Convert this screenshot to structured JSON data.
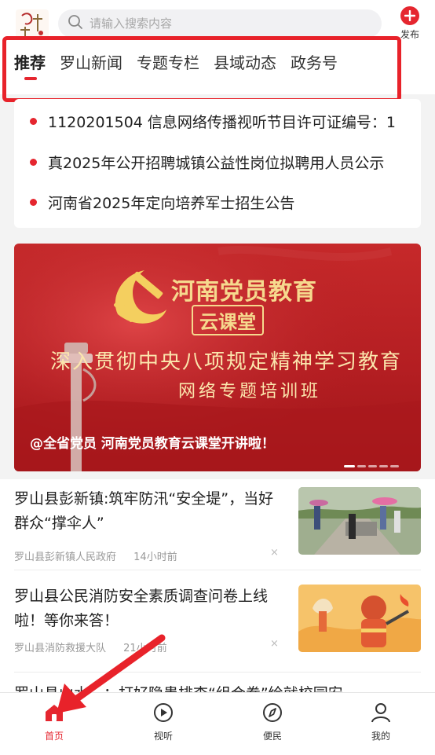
{
  "header": {
    "search_placeholder": "请输入搜索内容",
    "publish_label": "发布"
  },
  "tabs": [
    {
      "label": "推荐",
      "active": true
    },
    {
      "label": "罗山新闻",
      "active": false
    },
    {
      "label": "专题专栏",
      "active": false
    },
    {
      "label": "县域动态",
      "active": false
    },
    {
      "label": "政务号",
      "active": false
    }
  ],
  "notices": [
    "1120201504  信息网络传播视听节目许可证编号：1",
    "真2025年公开招聘城镇公益性岗位拟聘用人员公示",
    "河南省2025年定向培养军士招生公告"
  ],
  "banner": {
    "title": "河南党员教育",
    "subtitle": "云课堂",
    "line1": "深入贯彻中央八项规定精神学习教育",
    "line2": "网络专题培训班",
    "caption": "@全省党员 河南党员教育云课堂开讲啦！",
    "slide_count": 5,
    "active_slide": 1
  },
  "articles": [
    {
      "title": "罗山县彭新镇:筑牢防汛“安全堤”，当好群众“撑伞人”",
      "source": "罗山县彭新镇人民政府",
      "time": "14小时前",
      "close": "×",
      "thumb_icon": "flood-inspection-photo"
    },
    {
      "title": "罗山县公民消防安全素质调查问卷上线啦！等你来答！",
      "source": "罗山县消防救援大队",
      "time": "21小时前",
      "close": "×",
      "thumb_icon": "firefighter-illustration"
    },
    {
      "title": "罗山县山水…：打好隐患排查“组合拳”绘就校园安",
      "source": "",
      "time": "",
      "close": "",
      "thumb_icon": ""
    }
  ],
  "bottom_nav": [
    {
      "label": "首页",
      "icon": "home-icon",
      "active": true
    },
    {
      "label": "视听",
      "icon": "play-icon",
      "active": false
    },
    {
      "label": "便民",
      "icon": "compass-icon",
      "active": false
    },
    {
      "label": "我的",
      "icon": "user-icon",
      "active": false
    }
  ],
  "colors": {
    "accent": "#e5262f",
    "highlight_box": "#e8222a",
    "banner_red": "#b41e22",
    "banner_gold": "#f6d98e"
  }
}
